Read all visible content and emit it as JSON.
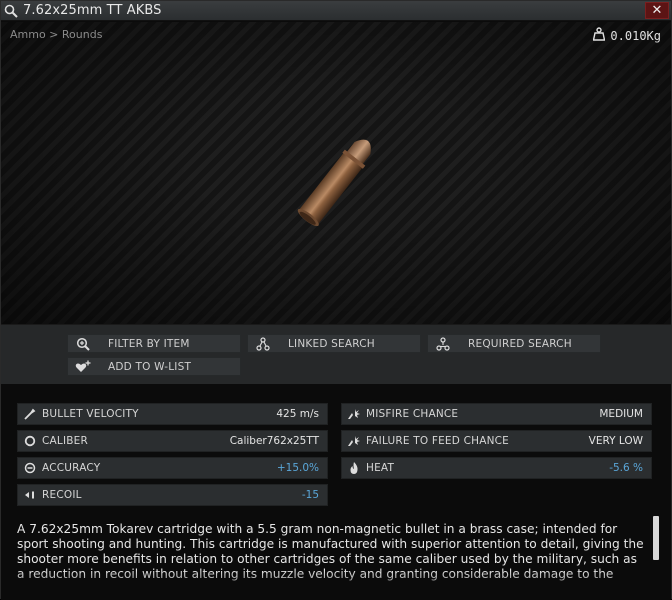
{
  "window": {
    "title": "7.62x25mm TT AKBS",
    "close_label": "✕"
  },
  "preview": {
    "breadcrumb": "Ammo > Rounds",
    "weight": "0.010Kg"
  },
  "actions": [
    {
      "label": "FILTER BY ITEM",
      "icon": "magnifier-plus-icon"
    },
    {
      "label": "LINKED SEARCH",
      "icon": "linked-nodes-icon"
    },
    {
      "label": "REQUIRED SEARCH",
      "icon": "required-nodes-icon"
    },
    {
      "label": "ADD TO W-LIST",
      "icon": "heart-plus-icon"
    }
  ],
  "stats": {
    "left": [
      {
        "name": "BULLET VELOCITY",
        "value": "425 m/s",
        "icon": "bullet-icon"
      },
      {
        "name": "CALIBER",
        "value": "Caliber762x25TT",
        "icon": "circle-icon"
      },
      {
        "name": "ACCURACY",
        "value": "+15.0%",
        "icon": "crosshair-icon",
        "highlight": true
      },
      {
        "name": "RECOIL",
        "value": "-15",
        "icon": "recoil-icon",
        "highlight": true
      }
    ],
    "right": [
      {
        "name": "MISFIRE CHANCE",
        "value": "MEDIUM",
        "icon": "misfire-icon"
      },
      {
        "name": "FAILURE TO FEED CHANCE",
        "value": "VERY LOW",
        "icon": "misfire-icon"
      },
      {
        "name": "HEAT",
        "value": "-5.6 %",
        "icon": "flame-icon",
        "highlight": true
      }
    ]
  },
  "description": "A 7.62x25mm Tokarev cartridge with a 5.5 gram non-magnetic bullet in a brass case; intended for sport shooting and hunting. This cartridge is manufactured with superior attention to detail, giving the shooter more benefits in relation to other cartridges of the same caliber used by the military, such as a reduction in recoil without altering its muzzle velocity and granting considerable damage to the",
  "colors": {
    "accent_value": "#5aa6d8",
    "close_button": "#5c1414"
  }
}
